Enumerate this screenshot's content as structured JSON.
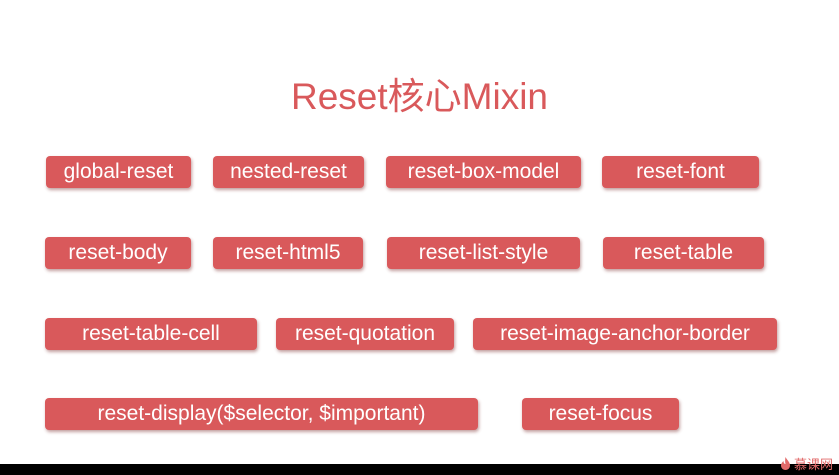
{
  "title": "Reset核心Mixin",
  "chips": {
    "global_reset": "global-reset",
    "nested_reset": "nested-reset",
    "reset_box_model": "reset-box-model",
    "reset_font": "reset-font",
    "reset_body": "reset-body",
    "reset_html5": "reset-html5",
    "reset_list_style": "reset-list-style",
    "reset_table": "reset-table",
    "reset_table_cell": "reset-table-cell",
    "reset_quotation": "reset-quotation",
    "reset_image_anchor_border": "reset-image-anchor-border",
    "reset_display": "reset-display($selector, $important)",
    "reset_focus": "reset-focus"
  },
  "watermark": "慕课网",
  "colors": {
    "accent": "#d9595b",
    "background": "#ffffff",
    "frame": "#000000"
  }
}
